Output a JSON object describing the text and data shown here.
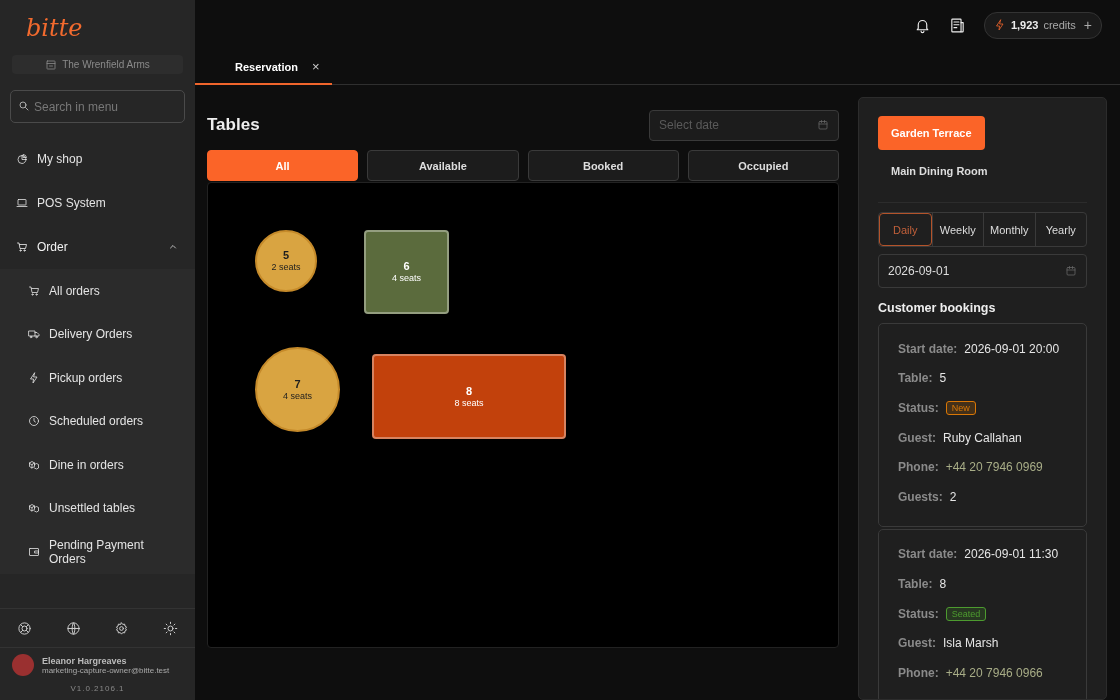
{
  "sidebar": {
    "logo": "bitte",
    "venue": "The Wrenfield Arms",
    "search": {
      "placeholder": "Search in menu"
    },
    "items": [
      {
        "label": "My shop"
      },
      {
        "label": "POS System"
      },
      {
        "label": "Order",
        "expanded": true,
        "children": [
          {
            "label": "All orders"
          },
          {
            "label": "Delivery Orders"
          },
          {
            "label": "Pickup orders"
          },
          {
            "label": "Scheduled orders"
          },
          {
            "label": "Dine in orders"
          },
          {
            "label": "Unsettled tables"
          },
          {
            "label": "Pending Payment Orders"
          }
        ]
      }
    ],
    "user": {
      "name": "Eleanor Hargreaves",
      "email": "marketing-capture-owner@bitte.test"
    },
    "version": "V1.0.2106.1"
  },
  "header": {
    "credits": "1,923",
    "credits_label": "credits",
    "plus": "+"
  },
  "tabs": [
    {
      "label": "Reservation",
      "selected": true,
      "close": "×"
    }
  ],
  "tables_panel": {
    "title": "Tables",
    "date": {
      "placeholder": "Select date"
    },
    "filters": [
      {
        "label": "All",
        "selected": true
      },
      {
        "label": "Available",
        "selected": false
      },
      {
        "label": "Booked",
        "selected": false
      },
      {
        "label": "Occupied",
        "selected": false
      }
    ],
    "tables": [
      {
        "number": "5",
        "seats": "2 seats",
        "kind": "round",
        "color": "#d9a441"
      },
      {
        "number": "6",
        "seats": "4 seats",
        "kind": "square",
        "color": "#5b6b3d"
      },
      {
        "number": "7",
        "seats": "4 seats",
        "kind": "round",
        "color": "#d9a441"
      },
      {
        "number": "8",
        "seats": "8 seats",
        "kind": "square",
        "color": "#c2410c"
      }
    ]
  },
  "bookings_panel": {
    "areas": [
      {
        "label": "Garden Terrace",
        "selected": true
      },
      {
        "label": "Main Dining Room",
        "selected": false
      }
    ],
    "periods": [
      {
        "label": "Daily",
        "selected": true
      },
      {
        "label": "Weekly",
        "selected": false
      },
      {
        "label": "Monthly",
        "selected": false
      },
      {
        "label": "Yearly",
        "selected": false
      }
    ],
    "date": "2026-09-01",
    "title": "Customer bookings",
    "bookings": [
      {
        "fields": [
          {
            "label": "Start date:",
            "value": "2026-09-01 20:00",
            "kind": "text"
          },
          {
            "label": "Table:",
            "value": "5",
            "kind": "text"
          },
          {
            "label": "Status:",
            "value": "New",
            "kind": "badge",
            "color": "#d97706"
          },
          {
            "label": "Guest:",
            "value": "Ruby Callahan",
            "kind": "text"
          },
          {
            "label": "Phone:",
            "value": "+44 20 7946 0969",
            "kind": "phone"
          },
          {
            "label": "Guests:",
            "value": "2",
            "kind": "text"
          }
        ]
      },
      {
        "fields": [
          {
            "label": "Start date:",
            "value": "2026-09-01 11:30",
            "kind": "text"
          },
          {
            "label": "Table:",
            "value": "8",
            "kind": "text"
          },
          {
            "label": "Status:",
            "value": "Seated",
            "kind": "badge",
            "color": "#4d9b2f"
          },
          {
            "label": "Guest:",
            "value": "Isla Marsh",
            "kind": "text"
          },
          {
            "label": "Phone:",
            "value": "+44 20 7946 0966",
            "kind": "phone"
          }
        ]
      }
    ]
  }
}
